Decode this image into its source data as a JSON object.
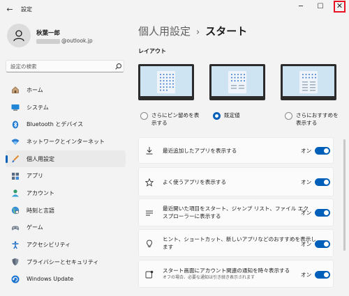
{
  "window": {
    "title": "設定",
    "back_glyph": "←",
    "minimize_glyph": "─",
    "maximize_glyph": "☐",
    "close_glyph": "✕"
  },
  "profile": {
    "name": "秋葉一郎",
    "email": "@outlook.jp"
  },
  "search": {
    "placeholder": "設定の検索"
  },
  "sidebar": {
    "items": [
      {
        "label": "ホーム",
        "icon": "home-icon",
        "active": false
      },
      {
        "label": "システム",
        "icon": "system-icon",
        "active": false
      },
      {
        "label": "Bluetooth とデバイス",
        "icon": "bluetooth-icon",
        "active": false
      },
      {
        "label": "ネットワークとインターネット",
        "icon": "wifi-icon",
        "active": false
      },
      {
        "label": "個人用設定",
        "icon": "paintbrush-icon",
        "active": true
      },
      {
        "label": "アプリ",
        "icon": "apps-icon",
        "active": false
      },
      {
        "label": "アカウント",
        "icon": "account-icon",
        "active": false
      },
      {
        "label": "時刻と言語",
        "icon": "globe-icon",
        "active": false
      },
      {
        "label": "ゲーム",
        "icon": "gamepad-icon",
        "active": false
      },
      {
        "label": "アクセシビリティ",
        "icon": "accessibility-icon",
        "active": false
      },
      {
        "label": "プライバシーとセキュリティ",
        "icon": "shield-icon",
        "active": false
      },
      {
        "label": "Windows Update",
        "icon": "update-icon",
        "active": false
      }
    ]
  },
  "main": {
    "breadcrumb_parent": "個人用設定",
    "breadcrumb_sep": "›",
    "breadcrumb_current": "スタート",
    "layout_label": "レイアウト",
    "layout_options": [
      {
        "label_line1": "さらにピン留めを表",
        "label_line2": "示する",
        "selected": false
      },
      {
        "label_line1": "既定値",
        "label_line2": "",
        "selected": true
      },
      {
        "label_line1": "さらにおすすめを",
        "label_line2": "表示する",
        "selected": false
      }
    ],
    "settings": [
      {
        "icon": "download-icon",
        "line1": "最近追加したアプリを表示する",
        "line2": "",
        "sub": "",
        "state": "オン"
      },
      {
        "icon": "star-icon",
        "line1": "よく使うアプリを表示する",
        "line2": "",
        "sub": "",
        "state": "オン"
      },
      {
        "icon": "list-icon",
        "line1": "最近開いた項目をスタート、ジャンプ リスト、ファイル エク",
        "line2": "スプローラーに表示する",
        "sub": "",
        "state": "オン"
      },
      {
        "icon": "lightbulb-icon",
        "line1": "ヒント、ショートカット、新しいアプリなどのおすすめを表示し",
        "line2": "ます",
        "sub": "",
        "state": "オン"
      },
      {
        "icon": "notification-icon",
        "line1": "スタート画面にアカウント関連の通知を時々表示する",
        "line2": "",
        "sub": "オフの場合、必要な通知は引き続き表示されます",
        "state": "オン"
      }
    ]
  },
  "colors": {
    "accent": "#005fb8",
    "close_highlight": "#e81123"
  }
}
